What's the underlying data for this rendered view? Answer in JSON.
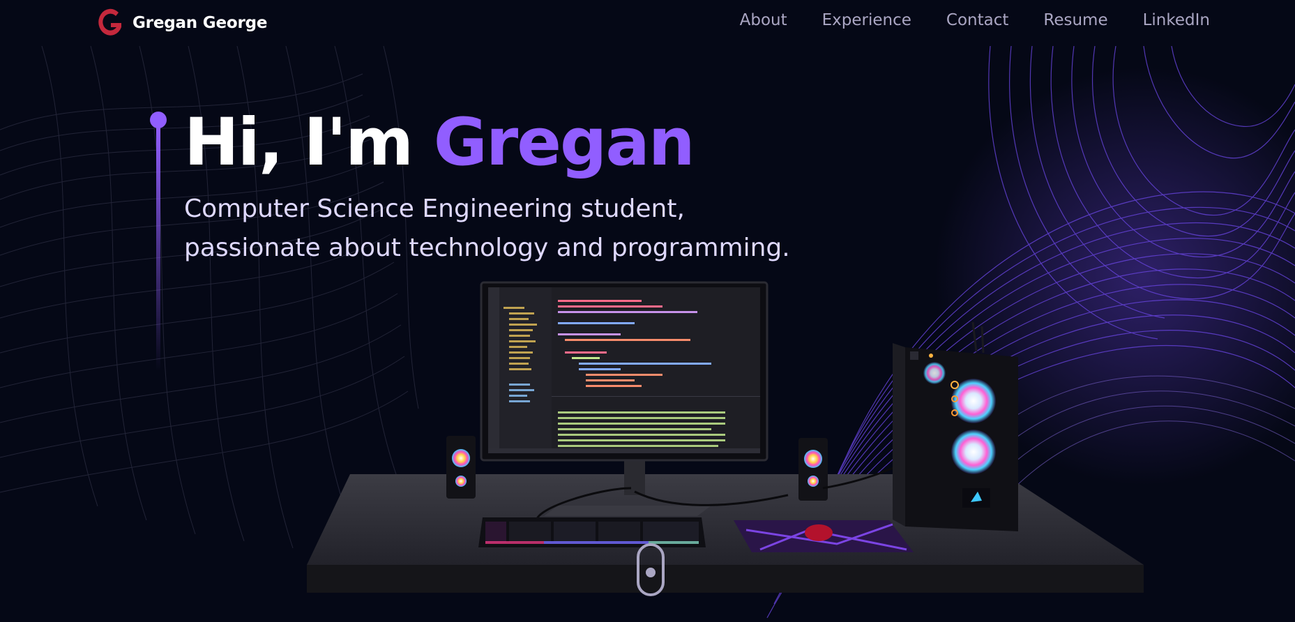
{
  "nav": {
    "brand_name": "Gregan George",
    "links": [
      {
        "label": "About"
      },
      {
        "label": "Experience"
      },
      {
        "label": "Contact"
      },
      {
        "label": "Resume"
      },
      {
        "label": "LinkedIn"
      }
    ]
  },
  "hero": {
    "title_prefix": "Hi, I'm ",
    "title_name": "Gregan",
    "subtitle_line1": "Computer Science Engineering student,",
    "subtitle_line2": "passionate about technology and programming."
  },
  "colors": {
    "background": "#050816",
    "accent": "#915eff",
    "brand_red": "#c4283c",
    "nav_link": "#aaa6c3"
  },
  "icons": {
    "brand": "g-logo-icon",
    "scroll": "mouse-scroll-icon"
  }
}
